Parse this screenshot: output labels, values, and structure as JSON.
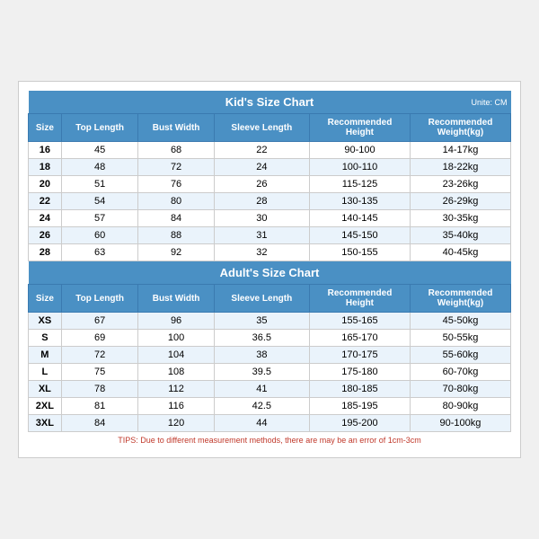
{
  "kids": {
    "title": "Kid's Size Chart",
    "unit": "Unite: CM",
    "headers": [
      "Size",
      "Top Length",
      "Bust Width",
      "Sleeve Length",
      "Recommended\nHeight",
      "Recommended\nWeight(kg)"
    ],
    "rows": [
      [
        "16",
        "45",
        "68",
        "22",
        "90-100",
        "14-17kg"
      ],
      [
        "18",
        "48",
        "72",
        "24",
        "100-110",
        "18-22kg"
      ],
      [
        "20",
        "51",
        "76",
        "26",
        "115-125",
        "23-26kg"
      ],
      [
        "22",
        "54",
        "80",
        "28",
        "130-135",
        "26-29kg"
      ],
      [
        "24",
        "57",
        "84",
        "30",
        "140-145",
        "30-35kg"
      ],
      [
        "26",
        "60",
        "88",
        "31",
        "145-150",
        "35-40kg"
      ],
      [
        "28",
        "63",
        "92",
        "32",
        "150-155",
        "40-45kg"
      ]
    ]
  },
  "adults": {
    "title": "Adult's Size Chart",
    "headers": [
      "Size",
      "Top Length",
      "Bust Width",
      "Sleeve Length",
      "Recommended\nHeight",
      "Recommended\nWeight(kg)"
    ],
    "rows": [
      [
        "XS",
        "67",
        "96",
        "35",
        "155-165",
        "45-50kg"
      ],
      [
        "S",
        "69",
        "100",
        "36.5",
        "165-170",
        "50-55kg"
      ],
      [
        "M",
        "72",
        "104",
        "38",
        "170-175",
        "55-60kg"
      ],
      [
        "L",
        "75",
        "108",
        "39.5",
        "175-180",
        "60-70kg"
      ],
      [
        "XL",
        "78",
        "112",
        "41",
        "180-185",
        "70-80kg"
      ],
      [
        "2XL",
        "81",
        "116",
        "42.5",
        "185-195",
        "80-90kg"
      ],
      [
        "3XL",
        "84",
        "120",
        "44",
        "195-200",
        "90-100kg"
      ]
    ]
  },
  "tips": "TIPS: Due to different measurement methods, there are may be an error of 1cm-3cm"
}
